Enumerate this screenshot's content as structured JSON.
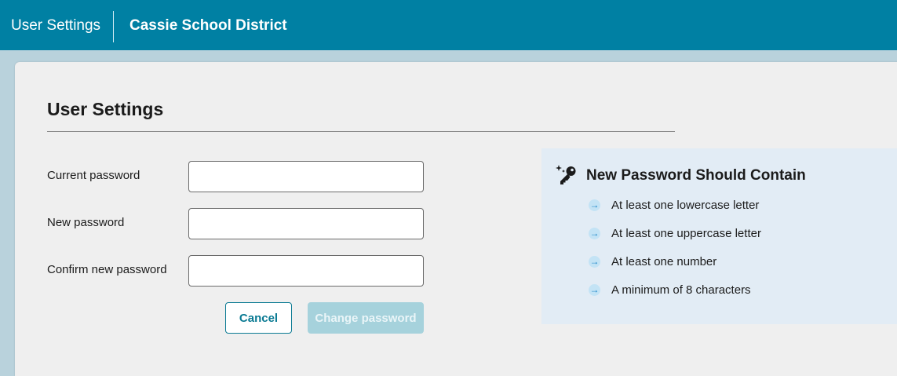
{
  "header": {
    "app_title": "User Settings",
    "org_name": "Cassie School District"
  },
  "main": {
    "title": "User Settings",
    "fields": [
      {
        "label": "Current password",
        "value": "",
        "placeholder": ""
      },
      {
        "label": "New password",
        "value": "",
        "placeholder": ""
      },
      {
        "label": "Confirm new password",
        "value": "",
        "placeholder": ""
      }
    ],
    "cancel_label": "Cancel",
    "change_label": "Change password",
    "change_disabled": true
  },
  "requirements": {
    "icon": "key-sparkle-icon",
    "title": "New Password Should Contain",
    "items": [
      {
        "icon": "arrow-right-icon",
        "text": "At least one lowercase letter"
      },
      {
        "icon": "arrow-right-icon",
        "text": "At least one uppercase letter"
      },
      {
        "icon": "arrow-right-icon",
        "text": "At least one number"
      },
      {
        "icon": "arrow-right-icon",
        "text": "A minimum of 8 characters"
      }
    ]
  },
  "colors": {
    "header_bg": "#0080a3",
    "page_bg": "#b9d2dc",
    "card_bg": "#efefef",
    "panel_bg": "#e2ecf5",
    "accent": "#0a7a93",
    "disabled_button_bg": "#a6d2dc"
  }
}
